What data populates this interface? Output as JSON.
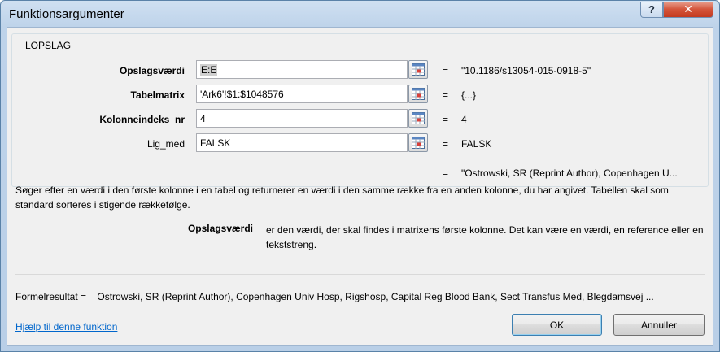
{
  "window": {
    "title": "Funktionsargumenter",
    "help_button": "?",
    "close_button": "✕"
  },
  "function_name": "LOPSLAG",
  "arguments": [
    {
      "label": "Opslagsværdi",
      "value": "E:E",
      "result": "\"10.1186/s13054-015-0918-5\""
    },
    {
      "label": "Tabelmatrix",
      "value": "'Ark6'!$1:$1048576",
      "result": "{...}"
    },
    {
      "label": "Kolonneindeks_nr",
      "value": "4",
      "result": "4"
    },
    {
      "label": "Lig_med",
      "value": "FALSK",
      "result": "FALSK"
    }
  ],
  "equals": "=",
  "overall_result": "\"Ostrowski, SR (Reprint Author), Copenhagen U...",
  "description": "Søger efter en værdi i den første kolonne i en tabel og returnerer en værdi i den samme række fra en anden kolonne, du har angivet. Tabellen skal som standard sorteres i stigende rækkefølge.",
  "param_help": {
    "name": "Opslagsværdi",
    "text": "er den værdi, der skal findes i matrixens første kolonne. Det kan være en værdi, en reference eller en tekststreng."
  },
  "formula_result": {
    "label": "Formelresultat =",
    "value": "Ostrowski, SR (Reprint Author), Copenhagen Univ Hosp, Rigshosp, Capital Reg Blood Bank, Sect Transfus Med, Blegdamsvej ..."
  },
  "help_link": "Hjælp til denne funktion",
  "buttons": {
    "ok": "OK",
    "cancel": "Annuller"
  }
}
